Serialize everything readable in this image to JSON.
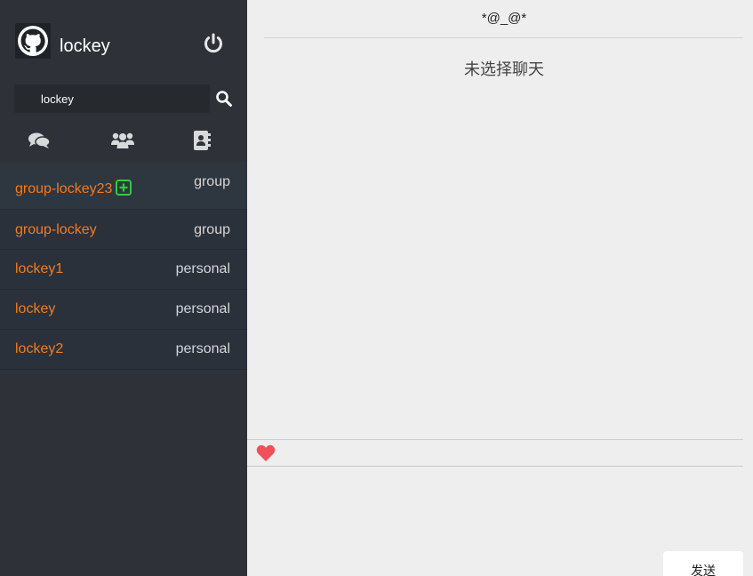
{
  "profile": {
    "username": "lockey",
    "avatar_icon": "github-icon",
    "logout_icon": "power-icon"
  },
  "search": {
    "value": "lockey",
    "button_icon": "search-icon"
  },
  "tabs": [
    {
      "icon": "comments-icon"
    },
    {
      "icon": "users-icon"
    },
    {
      "icon": "contacts-book-icon"
    }
  ],
  "conversations": [
    {
      "name": "group-lockey23",
      "type": "group",
      "badge_icon": "plus-square-icon"
    },
    {
      "name": "group-lockey",
      "type": "group"
    },
    {
      "name": "lockey1",
      "type": "personal"
    },
    {
      "name": "lockey",
      "type": "personal"
    },
    {
      "name": "lockey2",
      "type": "personal"
    }
  ],
  "chat": {
    "title": "*@_@*",
    "empty_text": "未选择聊天",
    "emoji_icon": "heart-icon",
    "send_label": "发送"
  },
  "colors": {
    "sidebar": "#2e3238",
    "accent_name": "#f07c23",
    "badge_green": "#2ecc40",
    "heart": "#f0505a"
  }
}
